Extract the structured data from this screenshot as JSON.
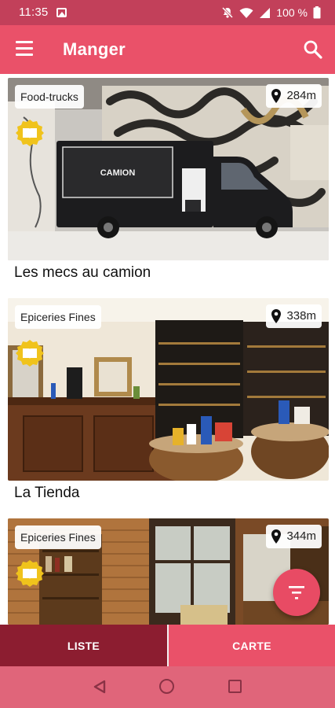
{
  "status_bar": {
    "time": "11:35",
    "battery_percent": "100 %",
    "icons": [
      "image-icon",
      "mute-icon",
      "wifi-icon",
      "signal-icon",
      "battery-icon"
    ]
  },
  "app_bar": {
    "title": "Manger",
    "menu_icon": "menu-icon",
    "search_icon": "search-icon",
    "color": "#ea5169"
  },
  "cards": [
    {
      "category": "Food-trucks",
      "distance": "284m",
      "name": "Les mecs au camion",
      "truck_brand": "CAMION",
      "book_badge": "book-icon"
    },
    {
      "category": "Epiceries Fines",
      "distance": "338m",
      "name": "La Tienda",
      "book_badge": "book-icon"
    },
    {
      "category": "Epiceries Fines",
      "distance": "344m",
      "name": "",
      "book_badge": "book-icon"
    }
  ],
  "fab": {
    "icon": "filter-icon",
    "color": "#e84b64"
  },
  "tabs": {
    "liste": "LISTE",
    "carte": "CARTE",
    "active": "LISTE",
    "active_color": "#8c1d30"
  },
  "system_nav": {
    "icons": [
      "back-icon",
      "home-icon",
      "recents-icon"
    ]
  }
}
